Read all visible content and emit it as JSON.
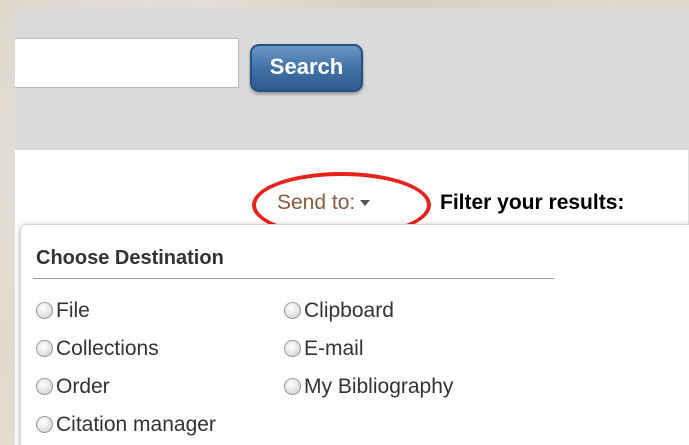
{
  "search": {
    "input_value": "",
    "button_label": "Search"
  },
  "toolbar": {
    "send_to_label": "Send to:",
    "filter_label": "Filter your results:"
  },
  "dropdown": {
    "title": "Choose Destination",
    "options_left": [
      "File",
      "Collections",
      "Order",
      "Citation manager"
    ],
    "options_right": [
      "Clipboard",
      "E-mail",
      "My Bibliography"
    ]
  },
  "colors": {
    "highlight": "#e8231c",
    "send_to_text": "#8a5a3c",
    "search_button": "#4272a8"
  },
  "icons": {
    "send_to_caret": "chevron-down-icon",
    "radio": "radio-button-icon"
  }
}
